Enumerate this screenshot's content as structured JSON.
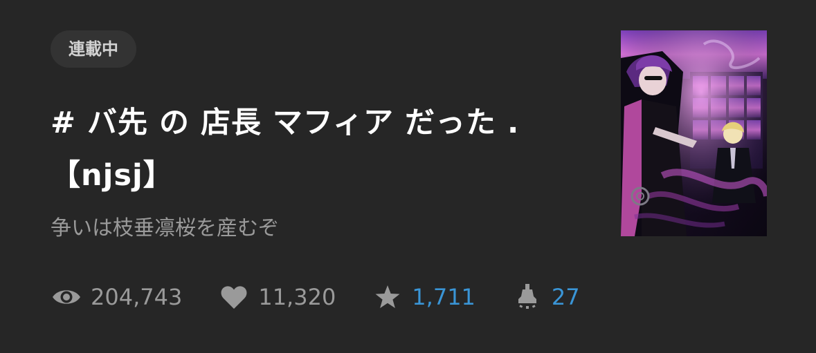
{
  "status_badge": "連載中",
  "title": "# バ先 の 店長 マフィア だった .【njsj】",
  "subtitle": "争いは枝垂凛桜を産むぞ",
  "stats": {
    "views": "204,743",
    "likes": "11,320",
    "bookmarks": "1,711",
    "comments": "27"
  },
  "icons": {
    "views": "eye-icon",
    "likes": "heart-icon",
    "bookmarks": "star-icon",
    "comments": "lamp-icon"
  },
  "colors": {
    "background": "#262626",
    "badge_bg": "#333333",
    "title": "#ffffff",
    "muted": "#9a9a9a",
    "accent_blue": "#3a95d6"
  }
}
